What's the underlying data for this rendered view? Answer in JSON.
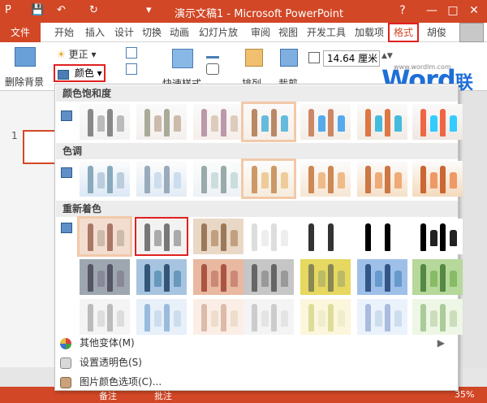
{
  "window": {
    "title": "演示文稿1 - Microsoft PowerPoint",
    "help": "?",
    "minimize": "—",
    "maximize": "□",
    "close": "✕"
  },
  "quick_access": {
    "save": "💾",
    "undo": "↶",
    "redo": "↻",
    "customize": "▾"
  },
  "tabs": [
    {
      "label": "文件"
    },
    {
      "label": "开始"
    },
    {
      "label": "插入"
    },
    {
      "label": "设计"
    },
    {
      "label": "切换"
    },
    {
      "label": "动画"
    },
    {
      "label": "幻灯片放"
    },
    {
      "label": "审阅"
    },
    {
      "label": "视图"
    },
    {
      "label": "开发工具"
    },
    {
      "label": "加载项"
    },
    {
      "label": "格式"
    },
    {
      "label": "胡俊"
    }
  ],
  "ribbon": {
    "remove_bg": "删除背景",
    "corrections": "更正",
    "color": "颜色",
    "quick_styles": "快速样式",
    "arrange": "排列",
    "crop": "裁剪",
    "size_value": "14.64 厘米"
  },
  "gallery": {
    "saturation_header": "颜色饱和度",
    "tone_header": "色调",
    "recolor_header": "重新着色"
  },
  "menu": {
    "more_variants": "其他变体(M)",
    "set_transparent": "设置透明色(S)",
    "picture_color_options": "图片颜色选项(C)..."
  },
  "slide_pane": {
    "slide_number": "1"
  },
  "status": {
    "notes": "备注",
    "comments": "批注",
    "zoom": "35%"
  },
  "watermark": {
    "brand": "Word",
    "brand_cn": "联盟",
    "url": "www.wordlm.com"
  },
  "colors": {
    "accent": "#d24726",
    "highlight": "#e02020",
    "brand_blue": "#1f6fd6"
  }
}
